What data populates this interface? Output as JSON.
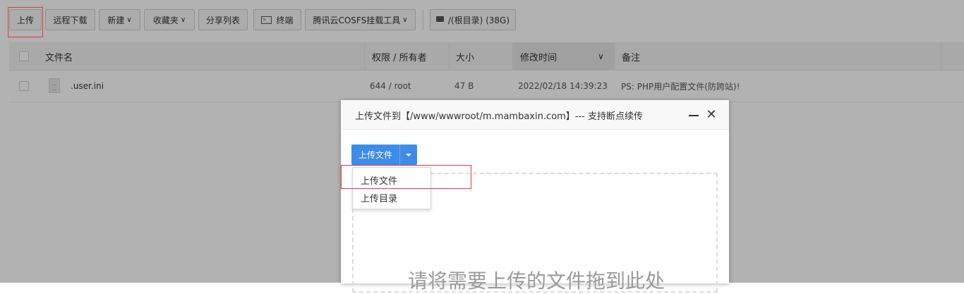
{
  "toolbar": {
    "upload": "上传",
    "remote_download": "远程下载",
    "new": "新建",
    "favorites": "收藏夹",
    "share_list": "分享列表",
    "terminal": "终端",
    "cosfs": "腾讯云COSFS挂载工具",
    "disk": "/(根目录) (38G)",
    "caret": "∨"
  },
  "table": {
    "headers": {
      "name": "文件名",
      "perm": "权限 / 所有者",
      "size": "大小",
      "mtime": "修改时间",
      "note": "备注"
    },
    "rows": [
      {
        "name": ".user.ini",
        "perm": "644 / root",
        "size": "47 B",
        "mtime": "2022/02/18 14:39:23",
        "note": "PS: PHP用户配置文件(防跨站)!"
      }
    ]
  },
  "dialog": {
    "title": "上传文件到【/www/wwwroot/m.mambaxin.com】--- 支持断点续传",
    "close": "✕",
    "upload_button": "上传文件",
    "menu": [
      "上传文件",
      "上传目录"
    ],
    "drop_text": "请将需要上传的文件拖到此处"
  },
  "colors": {
    "primary": "#3f8ce8",
    "highlight": "#e0393e"
  }
}
